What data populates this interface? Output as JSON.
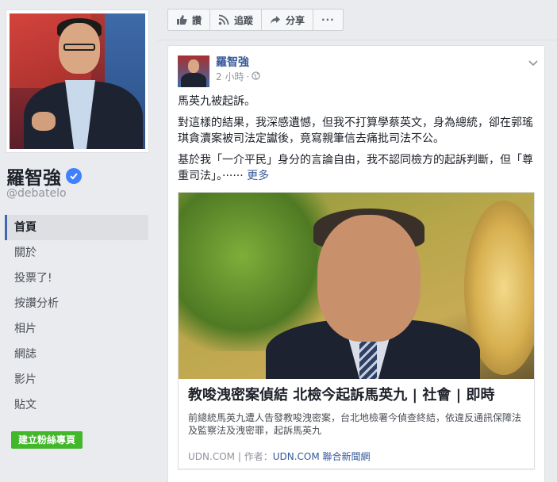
{
  "page": {
    "name": "羅智強",
    "username": "@debatelo",
    "nav_items": [
      {
        "label": "首頁",
        "active": true
      },
      {
        "label": "關於"
      },
      {
        "label": "投票了!"
      },
      {
        "label": "按讚分析"
      },
      {
        "label": "相片"
      },
      {
        "label": "網誌"
      },
      {
        "label": "影片"
      },
      {
        "label": "貼文"
      }
    ],
    "create_page_label": "建立粉絲專頁"
  },
  "toolbar": {
    "like_label": "讚",
    "follow_label": "追蹤",
    "share_label": "分享",
    "more_label": "···"
  },
  "post": {
    "author": "羅智強",
    "time": "2 小時",
    "paragraphs": [
      "馬英九被起訴。",
      "對這樣的結果，我深感遺憾，但我不打算學蔡英文，身為總統，卻在郭瑤琪貪瀆案被司法定讞後，竟寫親筆信去痛批司法不公。",
      "基於我「一介平民」身分的言論自由，我不認同檢方的起訴判斷，但「尊重司法」。······"
    ],
    "see_more": "更多",
    "link": {
      "title": "教唆洩密案偵結 北檢今起訴馬英九 | 社會 | 即時",
      "description": "前總統馬英九遭人告發教唆洩密案，台北地檢署今偵查終結，依違反通訊保障法及監察法及洩密罪，起訴馬英九",
      "source_domain": "UDN.COM",
      "author_prefix": "作者：",
      "author": "UDN.COM 聯合新聞網"
    }
  },
  "colors": {
    "brand_blue": "#4267b2",
    "link_blue": "#365899",
    "create_green": "#42b72a",
    "verified_blue": "#4080ff"
  }
}
